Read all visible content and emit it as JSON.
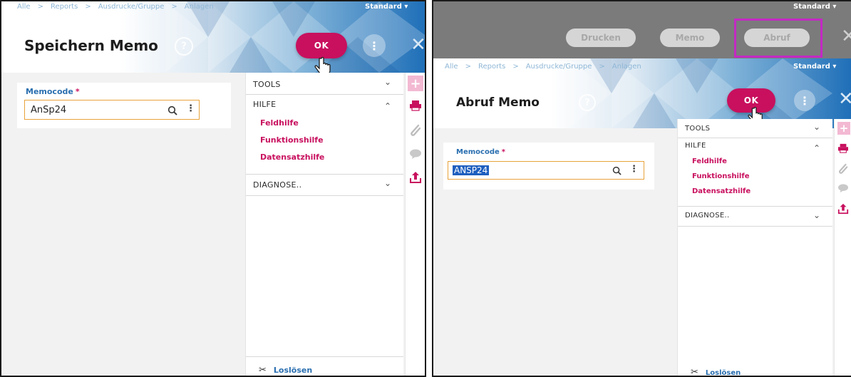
{
  "breadcrumb": [
    "Alle",
    "Reports",
    "Ausdrucke/Gruppe",
    "Anlagen"
  ],
  "layout_selector": "Standard ▾",
  "left": {
    "title": "Speichern Memo",
    "ok_label": "OK",
    "field": {
      "label": "Memocode",
      "required_mark": "*",
      "value": "AnSp24"
    }
  },
  "right": {
    "title": "Abruf Memo",
    "ok_label": "OK",
    "field": {
      "label": "Memocode",
      "required_mark": "*",
      "value": "ANSP24"
    },
    "actions": [
      "Drucken",
      "Memo",
      "Abruf"
    ]
  },
  "menu": {
    "tools": "TOOLS",
    "hilfe": "HILFE",
    "hilfe_links": [
      "Feldhilfe",
      "Funktionshilfe",
      "Datensatzhilfe"
    ],
    "diagnose": "DIAGNOSE..",
    "footer": "Loslösen"
  },
  "glyphs": {
    "help": "?",
    "more": "⋮",
    "close": "✕",
    "search": "🔍",
    "chev_down": "⌄",
    "chev_up": "⌃",
    "plus": "+"
  },
  "colors": {
    "accent": "#c8105e",
    "brand_blue": "#1f6fb8",
    "label_blue": "#2a6fb0",
    "field_border": "#e8a33c",
    "highlight": "#c429c4"
  }
}
